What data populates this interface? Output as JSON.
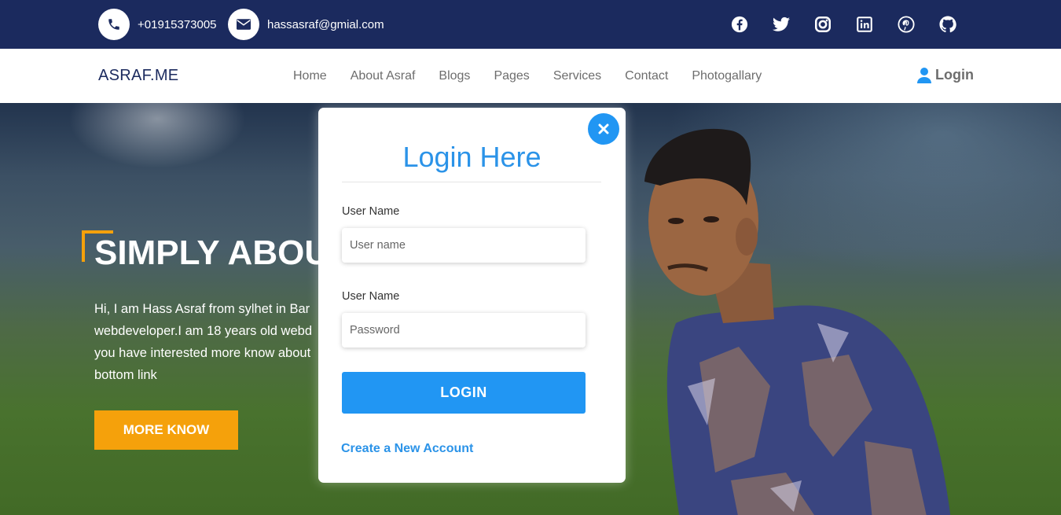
{
  "topbar": {
    "phone": "+01915373005",
    "email": "hassasraf@gmial.com",
    "social": [
      "facebook-icon",
      "twitter-icon",
      "instagram-icon",
      "linkedin-icon",
      "pinterest-icon",
      "github-icon"
    ]
  },
  "nav": {
    "brand": "ASRAF.ME",
    "items": [
      "Home",
      "About Asraf",
      "Blogs",
      "Pages",
      "Services",
      "Contact",
      "Photogallary"
    ],
    "login": "Login"
  },
  "hero": {
    "title": "SIMPLY ABOUT",
    "lines": [
      "Hi, I am Hass Asraf from sylhet in Bar",
      "webdeveloper.I am 18 years old webd",
      "you have interested more know about",
      "bottom link"
    ],
    "button": "MORE KNOW"
  },
  "modal": {
    "title": "Login Here",
    "username_label": "User Name",
    "username_placeholder": "User name",
    "password_label": "User Name",
    "password_placeholder": "Password",
    "submit": "LOGIN",
    "create_account": "Create a New Account"
  },
  "colors": {
    "navy": "#1b2a5e",
    "accent_blue": "#2196f3",
    "orange": "#f5a10b"
  }
}
